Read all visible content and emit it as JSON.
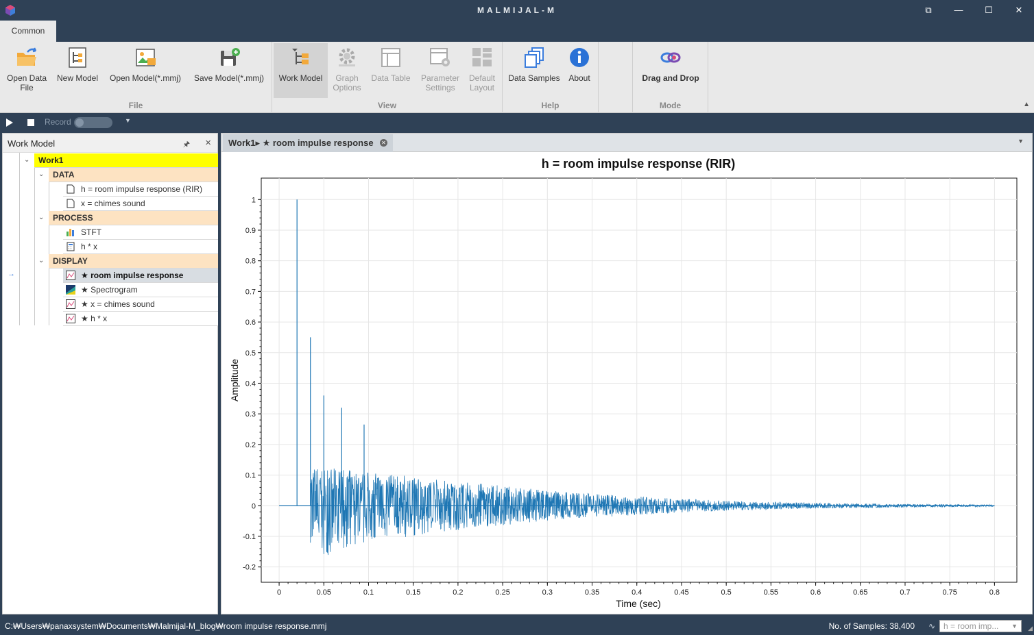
{
  "app": {
    "title": "MALMIJAL-M"
  },
  "window_controls": {
    "restore_icon": "⧉",
    "minimize_icon": "—",
    "maximize_icon": "☐",
    "close_icon": "✕"
  },
  "ribbon_tab": "Common",
  "ribbon": {
    "file": {
      "label": "File",
      "open_data_file": "Open Data File",
      "new_model": "New Model",
      "open_model": "Open Model(*.mmj)",
      "save_model": "Save Model(*.mmj)"
    },
    "view": {
      "label": "View",
      "work_model": "Work Model",
      "graph_options": "Graph Options",
      "data_table": "Data Table",
      "parameter_settings": "Parameter Settings",
      "default_layout": "Default Layout"
    },
    "help": {
      "label": "Help",
      "data_samples": "Data Samples",
      "about": "About"
    },
    "mode": {
      "label": "Mode",
      "drag_and_drop": "Drag and Drop"
    }
  },
  "record_bar": {
    "record_label": "Record"
  },
  "work_model_panel": {
    "title": "Work Model",
    "root": "Work1",
    "data_label": "DATA",
    "data_items": [
      "h = room impulse response (RIR)",
      "x = chimes sound"
    ],
    "process_label": "PROCESS",
    "process_items": [
      "STFT",
      "h * x"
    ],
    "display_label": "DISPLAY",
    "display_items": [
      "★ room impulse response",
      "★ Spectrogram",
      "★ x = chimes sound",
      "★ h * x"
    ]
  },
  "document_tab": {
    "label": "Work1▸ ★ room impulse response"
  },
  "chart_data": {
    "type": "line",
    "title": "h = room impulse response (RIR)",
    "xlabel": "Time (sec)",
    "ylabel": "Amplitude",
    "xlim": [
      -0.02,
      0.825
    ],
    "ylim": [
      -0.25,
      1.07
    ],
    "x_ticks": [
      "0",
      "0.05",
      "0.1",
      "0.15",
      "0.2",
      "0.25",
      "0.3",
      "0.35",
      "0.4",
      "0.45",
      "0.5",
      "0.55",
      "0.6",
      "0.65",
      "0.7",
      "0.75",
      "0.8"
    ],
    "y_ticks": [
      "1",
      "0.9",
      "0.8",
      "0.7",
      "0.6",
      "0.5",
      "0.4",
      "0.3",
      "0.2",
      "0.1",
      "0",
      "-0.1",
      "-0.2"
    ],
    "grid": true,
    "color": "#1f77b4",
    "series": [
      {
        "x": [
          0,
          0.02,
          0.02,
          0.02,
          0.035,
          0.035,
          0.035,
          0.05,
          0.05,
          0.05,
          0.07,
          0.07,
          0.07,
          0.095,
          0.095,
          0.095,
          0.8
        ],
        "values": [
          0,
          0,
          1.0,
          0,
          0,
          0.55,
          0,
          0,
          0.36,
          0,
          0,
          0.32,
          0,
          0,
          0.265,
          0,
          0
        ]
      }
    ],
    "noise_envelope": {
      "start": 0.035,
      "end": 0.8,
      "upper": [
        [
          0.035,
          0.13
        ],
        [
          0.1,
          0.11
        ],
        [
          0.2,
          0.08
        ],
        [
          0.3,
          0.05
        ],
        [
          0.4,
          0.03
        ],
        [
          0.5,
          0.016
        ],
        [
          0.6,
          0.009
        ],
        [
          0.7,
          0.005
        ],
        [
          0.8,
          0.003
        ]
      ],
      "lower": [
        [
          0.035,
          -0.13
        ],
        [
          0.05,
          -0.17
        ],
        [
          0.1,
          -0.12
        ],
        [
          0.2,
          -0.08
        ],
        [
          0.3,
          -0.05
        ],
        [
          0.4,
          -0.03
        ],
        [
          0.5,
          -0.016
        ],
        [
          0.6,
          -0.009
        ],
        [
          0.7,
          -0.005
        ],
        [
          0.8,
          -0.003
        ]
      ]
    }
  },
  "status_bar": {
    "path": "C:₩Users₩panaxsystem₩Documents₩Malmijal-M_blog₩room impulse response.mmj",
    "samples": "No. of Samples: 38,400",
    "combo_value": "h = room imp..."
  }
}
